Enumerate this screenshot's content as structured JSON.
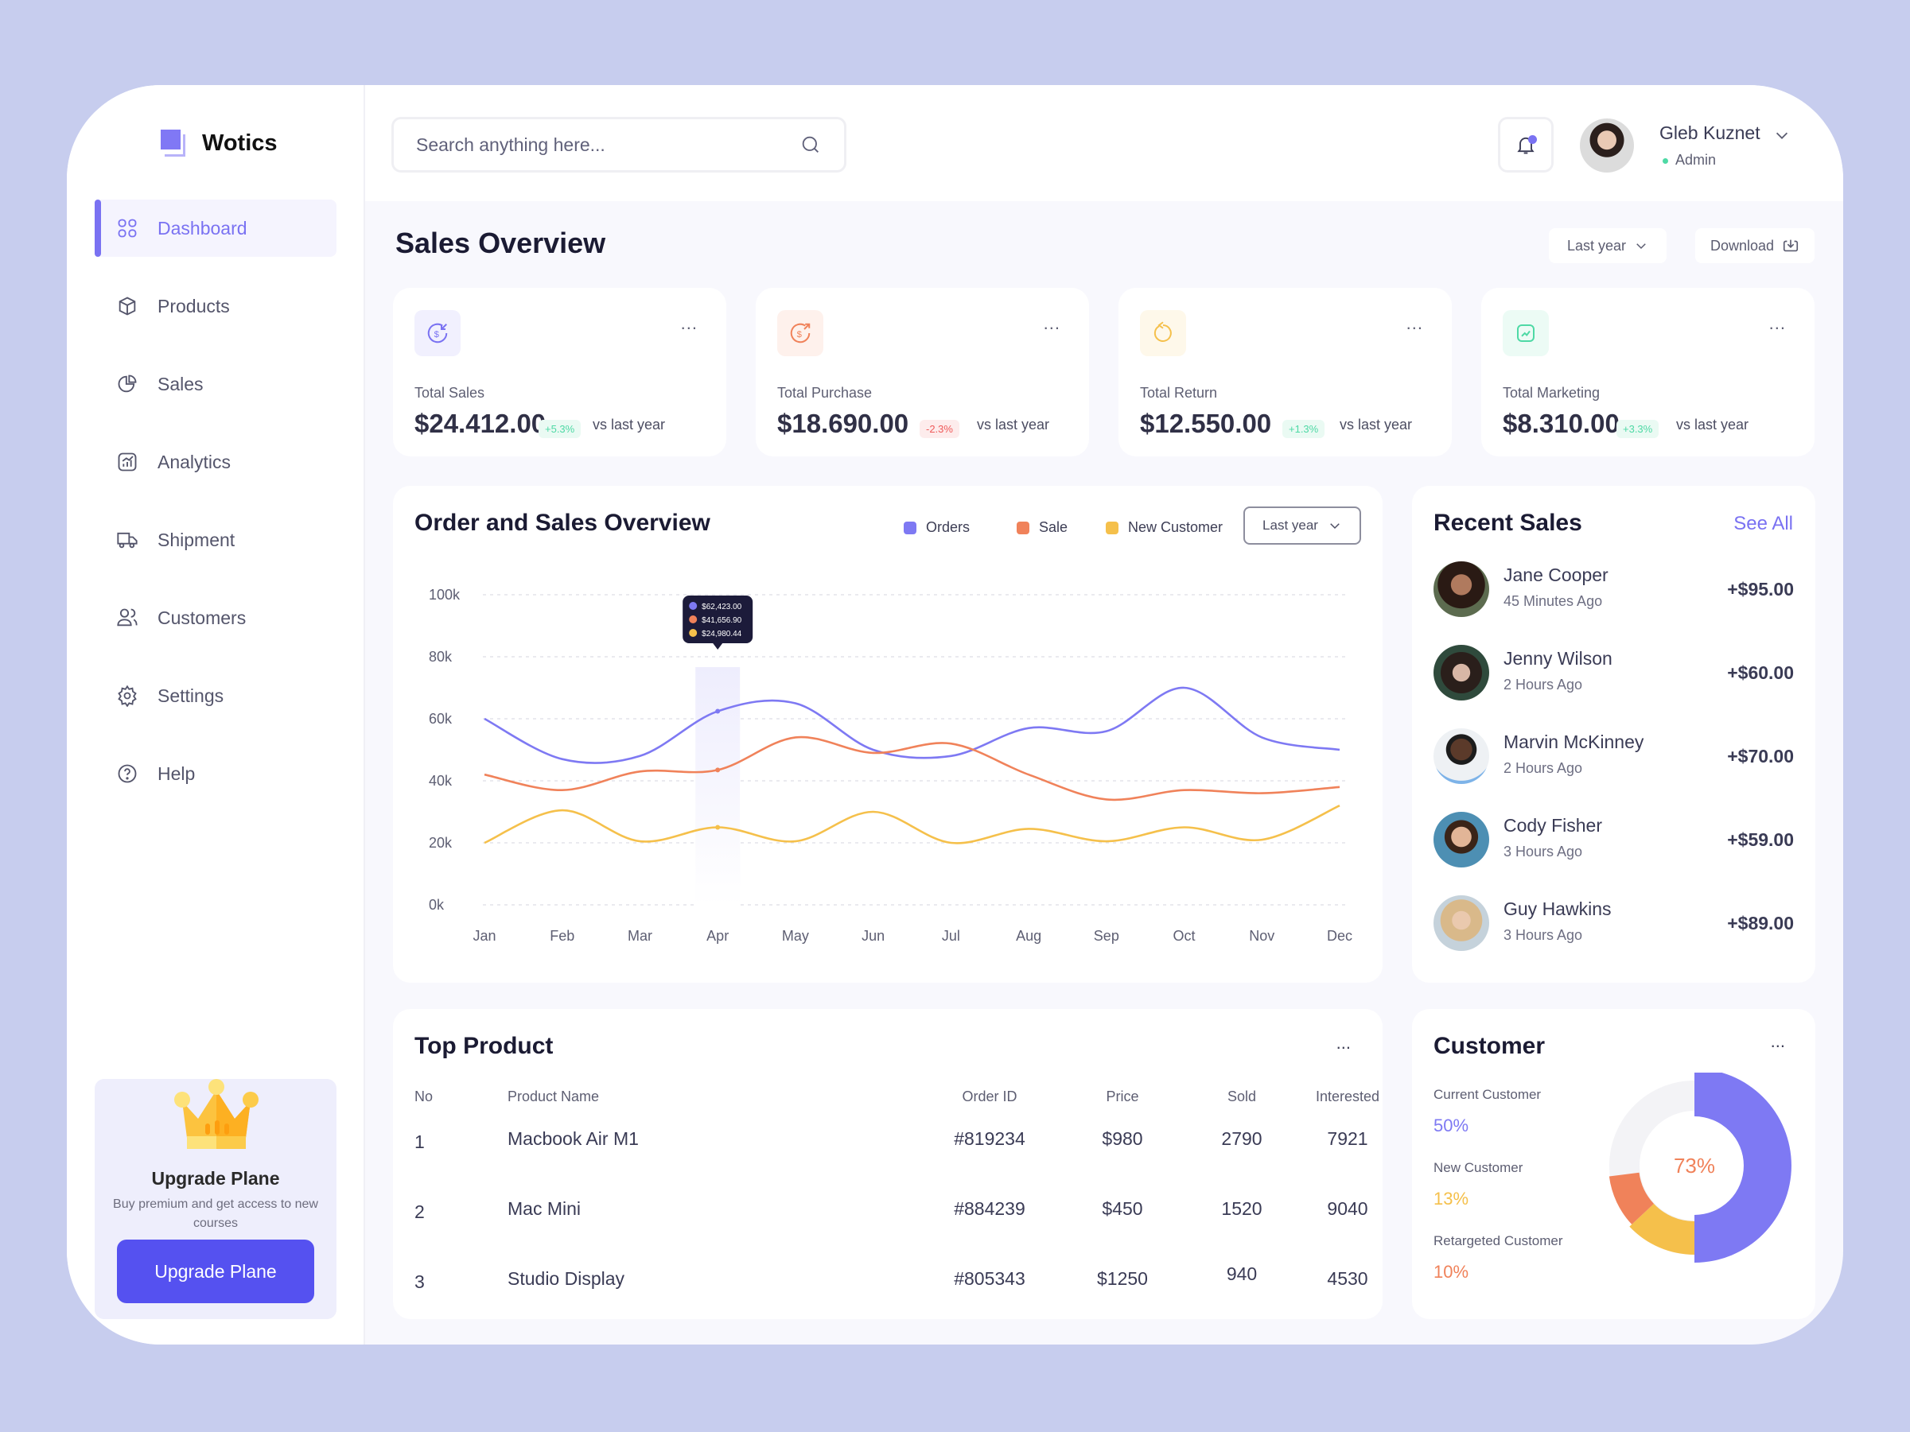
{
  "app": {
    "brand": "Wotics",
    "accent": "#7a72f2"
  },
  "sidebar": {
    "items": [
      {
        "label": "Dashboard",
        "icon": "grid-icon",
        "active": true
      },
      {
        "label": "Products",
        "icon": "box-icon",
        "active": false
      },
      {
        "label": "Sales",
        "icon": "pie-chart-icon",
        "active": false
      },
      {
        "label": "Analytics",
        "icon": "analytics-icon",
        "active": false
      },
      {
        "label": "Shipment",
        "icon": "truck-icon",
        "active": false
      },
      {
        "label": "Customers",
        "icon": "users-icon",
        "active": false
      },
      {
        "label": "Settings",
        "icon": "gear-icon",
        "active": false
      },
      {
        "label": "Help",
        "icon": "help-icon",
        "active": false
      }
    ],
    "upgrade": {
      "title": "Upgrade Plane",
      "subtitle": "Buy premium and get access to new courses",
      "button": "Upgrade Plane"
    }
  },
  "header": {
    "search_placeholder": "Search anything here...",
    "user": {
      "name": "Gleb Kuznet",
      "role": "Admin"
    }
  },
  "main": {
    "title": "Sales Overview",
    "period_label": "Last year",
    "download_label": "Download",
    "stats": [
      {
        "label": "Total Sales",
        "value": "$24.412.00",
        "change": "+5.3%",
        "trend": "up",
        "suffix": "vs last year",
        "icon": "dollar-in-icon",
        "color": "#7a72f2",
        "bg": "#f1f0fe"
      },
      {
        "label": "Total Purchase",
        "value": "$18.690.00",
        "change": "-2.3%",
        "trend": "down",
        "suffix": "vs last year",
        "icon": "dollar-out-icon",
        "color": "#f0825a",
        "bg": "#fef1ec"
      },
      {
        "label": "Total Return",
        "value": "$12.550.00",
        "change": "+1.3%",
        "trend": "up",
        "suffix": "vs last year",
        "icon": "return-icon",
        "color": "#f5c04b",
        "bg": "#fef8ea"
      },
      {
        "label": "Total Marketing",
        "value": "$8.310.00",
        "change": "+3.3%",
        "trend": "up",
        "suffix": "vs last year",
        "icon": "marketing-icon",
        "color": "#4ed9a5",
        "bg": "#ecfbf5"
      }
    ],
    "stat_more": "..."
  },
  "chart_data": {
    "type": "line",
    "title": "Order and Sales Overview",
    "filter_label": "Last year",
    "categories": [
      "Jan",
      "Feb",
      "Mar",
      "Apr",
      "May",
      "Jun",
      "Jul",
      "Aug",
      "Sep",
      "Oct",
      "Nov",
      "Dec"
    ],
    "yticks": [
      "0k",
      "20k",
      "40k",
      "60k",
      "80k",
      "100k"
    ],
    "ylim": [
      0,
      100000
    ],
    "grid": true,
    "legend_position": "top-right",
    "series": [
      {
        "name": "Orders",
        "color": "#7e79f3",
        "values": [
          60000,
          47000,
          48000,
          62423,
          65000,
          50000,
          48000,
          57000,
          56000,
          70000,
          54000,
          50000
        ]
      },
      {
        "name": "Sale",
        "color": "#f0825a",
        "values": [
          42000,
          37000,
          43000,
          43500,
          54000,
          49000,
          52000,
          42000,
          34000,
          37000,
          36000,
          38000
        ]
      },
      {
        "name": "New Customer",
        "color": "#f5c04b",
        "values": [
          20000,
          30500,
          20500,
          25000,
          20500,
          30000,
          20000,
          24500,
          20500,
          25000,
          21000,
          32000
        ]
      }
    ],
    "tooltip": {
      "category": "Apr",
      "values": [
        "$62,423.00",
        "$41,656.90",
        "$24,980.44"
      ]
    }
  },
  "recent_sales": {
    "title": "Recent Sales",
    "see_all": "See All",
    "items": [
      {
        "name": "Jane Cooper",
        "time": "45 Minutes Ago",
        "amount": "+$95.00"
      },
      {
        "name": "Jenny Wilson",
        "time": "2 Hours Ago",
        "amount": "+$60.00"
      },
      {
        "name": "Marvin McKinney",
        "time": "2 Hours Ago",
        "amount": "+$70.00"
      },
      {
        "name": "Cody Fisher",
        "time": "3 Hours Ago",
        "amount": "+$59.00"
      },
      {
        "name": "Guy Hawkins",
        "time": "3 Hours Ago",
        "amount": "+$89.00"
      }
    ]
  },
  "top_product": {
    "title": "Top Product",
    "more": "...",
    "columns": [
      "No",
      "Product Name",
      "Order ID",
      "Price",
      "Sold",
      "Interested"
    ],
    "rows": [
      {
        "no": "1",
        "name": "Macbook Air M1",
        "order_id": "#819234",
        "price": "$980",
        "sold": "2790",
        "interested": "7921"
      },
      {
        "no": "2",
        "name": "Mac Mini",
        "order_id": "#884239",
        "price": "$450",
        "sold": "1520",
        "interested": "9040"
      },
      {
        "no": "3",
        "name": "Studio Display",
        "order_id": "#805343",
        "price": "$1250",
        "sold": "940",
        "interested": "4530"
      }
    ]
  },
  "customer": {
    "title": "Customer",
    "more": "...",
    "center_label": "73%",
    "segments": [
      {
        "label": "Current Customer",
        "value": "50%",
        "percent": 50,
        "color": "#7e79f3"
      },
      {
        "label": "New Customer",
        "value": "13%",
        "percent": 13,
        "color": "#f5c04b"
      },
      {
        "label": "Retargeted Customer",
        "value": "10%",
        "percent": 10,
        "color": "#f0825a"
      }
    ]
  }
}
